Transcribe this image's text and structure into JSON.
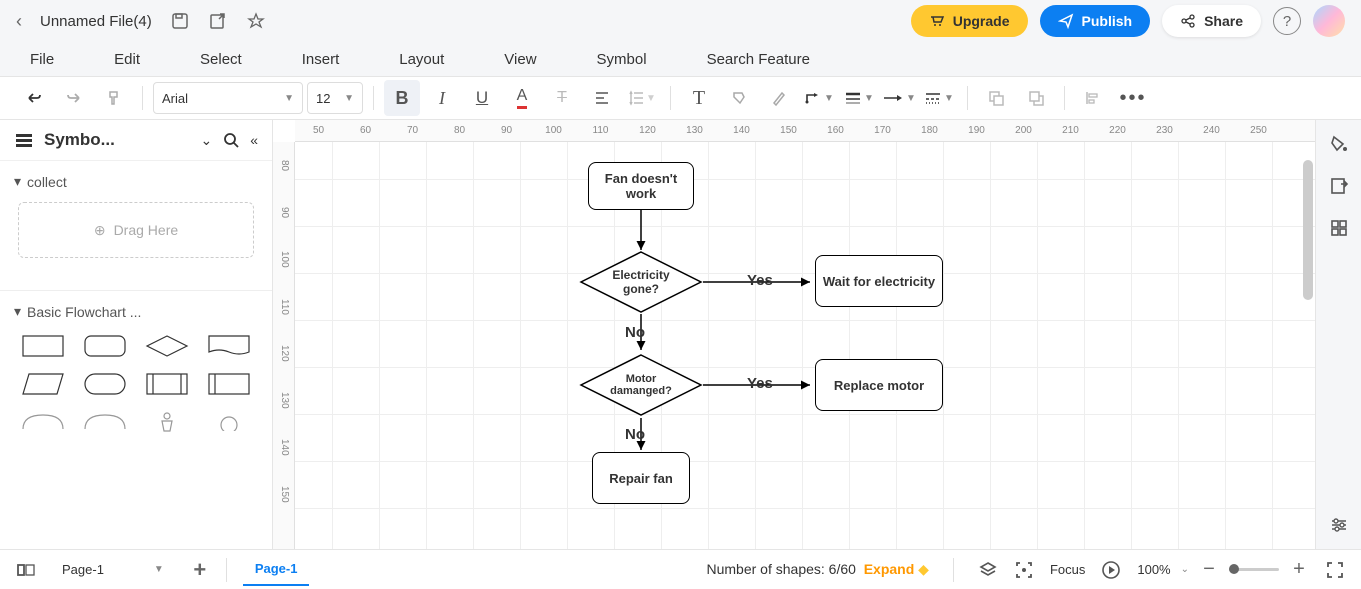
{
  "header": {
    "file_title": "Unnamed File(4)",
    "upgrade": "Upgrade",
    "publish": "Publish",
    "share": "Share"
  },
  "menu": [
    "File",
    "Edit",
    "Select",
    "Insert",
    "Layout",
    "View",
    "Symbol",
    "Search Feature"
  ],
  "toolbar": {
    "font": "Arial",
    "size": "12"
  },
  "sidebar": {
    "title": "Symbo...",
    "collect": "collect",
    "drag_here": "Drag Here",
    "basic_flowchart": "Basic Flowchart ..."
  },
  "ruler_h": [
    "50",
    "60",
    "70",
    "80",
    "90",
    "100",
    "110",
    "120",
    "130",
    "140",
    "150",
    "160",
    "170",
    "180",
    "190",
    "200",
    "210",
    "220",
    "230",
    "240",
    "250"
  ],
  "ruler_v": [
    "80",
    "90",
    "100",
    "110",
    "120",
    "130",
    "140",
    "150"
  ],
  "flowchart": {
    "start": "Fan doesn't work",
    "d1": "Electricity gone?",
    "d1_yes": "Yes",
    "d1_no": "No",
    "a1": "Wait for electricity",
    "d2": "Motor damanged?",
    "d2_yes": "Yes",
    "d2_no": "No",
    "a2": "Replace motor",
    "end": "Repair fan"
  },
  "bottom": {
    "page_select": "Page-1",
    "page_tab": "Page-1",
    "shape_count_label": "Number of shapes: ",
    "shape_count_value": "6/60",
    "expand": "Expand",
    "focus": "Focus",
    "zoom": "100%"
  }
}
